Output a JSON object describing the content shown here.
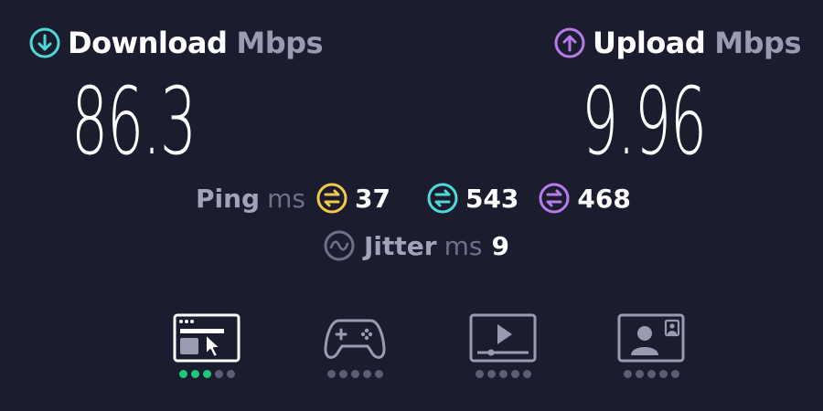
{
  "download": {
    "label": "Download",
    "unit": "Mbps",
    "value": "86.3",
    "accent": "#4fd8d8"
  },
  "upload": {
    "label": "Upload",
    "unit": "Mbps",
    "value": "9.96",
    "accent": "#b57bea"
  },
  "ping": {
    "label": "Ping",
    "unit": "ms",
    "idle": {
      "value": "37",
      "color": "#f0c94a",
      "icon": "idle-latency-icon"
    },
    "download": {
      "value": "543",
      "color": "#4fd8d8",
      "icon": "download-latency-icon"
    },
    "upload": {
      "value": "468",
      "color": "#b57bea",
      "icon": "upload-latency-icon"
    }
  },
  "jitter": {
    "label": "Jitter",
    "unit": "ms",
    "value": "9",
    "icon": "jitter-wave-icon"
  },
  "tests": [
    {
      "name": "web-browsing",
      "icon": "browser-cursor-icon",
      "rating": 3,
      "max": 5,
      "active": true
    },
    {
      "name": "gaming",
      "icon": "gamepad-icon",
      "rating": 0,
      "max": 5,
      "active": false
    },
    {
      "name": "video-streaming",
      "icon": "video-player-icon",
      "rating": 0,
      "max": 5,
      "active": false
    },
    {
      "name": "video-chat",
      "icon": "video-chat-icon",
      "rating": 0,
      "max": 5,
      "active": false
    }
  ],
  "colors": {
    "background": "#1b1c2e",
    "rating_on": "#1fc77b",
    "rating_off": "#5c5d74"
  }
}
